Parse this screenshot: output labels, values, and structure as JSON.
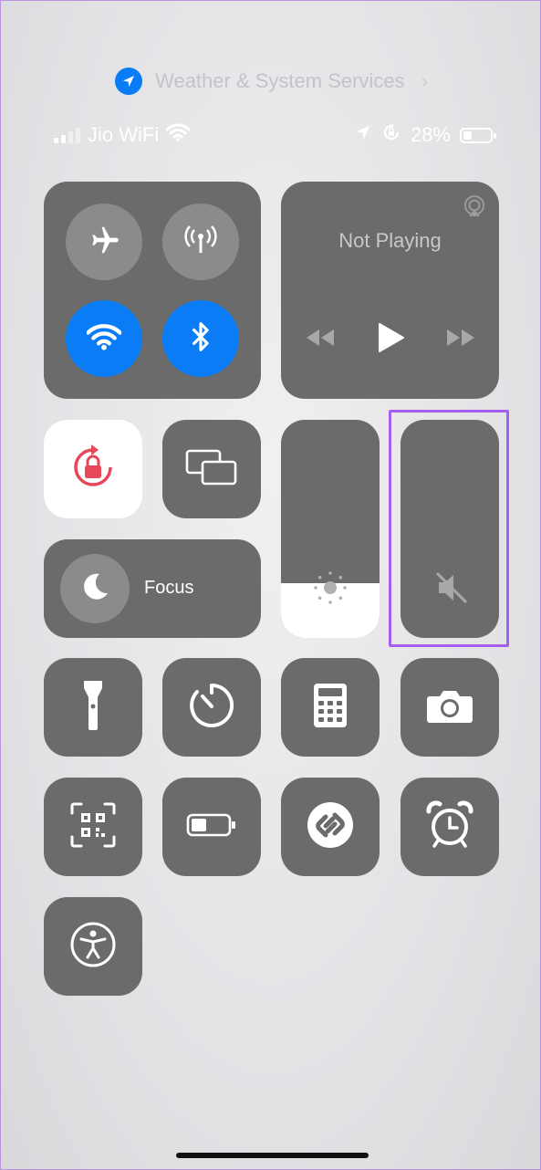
{
  "location_banner": {
    "text": "Weather & System Services",
    "chevron": "›",
    "icon": "location-arrow-icon"
  },
  "status_bar": {
    "carrier": "Jio WiFi",
    "battery_percent_text": "28%",
    "battery_level": 0.28,
    "icons": [
      "signal-icon",
      "wifi-icon",
      "location-arrow-icon",
      "rotation-lock-icon",
      "battery-icon"
    ]
  },
  "connectivity": {
    "airplane": {
      "state": "off"
    },
    "cellular": {
      "state": "off"
    },
    "wifi": {
      "state": "on"
    },
    "bluetooth": {
      "state": "on"
    }
  },
  "now_playing": {
    "label": "Not Playing"
  },
  "controls": {
    "orientation_lock": {
      "state": "on"
    },
    "screen_mirroring": {
      "state": "off"
    },
    "focus": {
      "label": "Focus"
    },
    "brightness": {
      "level": 0.25
    },
    "volume": {
      "level": 0,
      "muted": true
    }
  },
  "colors": {
    "tile": "#6b6b6b",
    "accent_blue": "#0a7cf5",
    "rotation_lock_red": "#e8475a",
    "highlight": "#a45ff0"
  }
}
